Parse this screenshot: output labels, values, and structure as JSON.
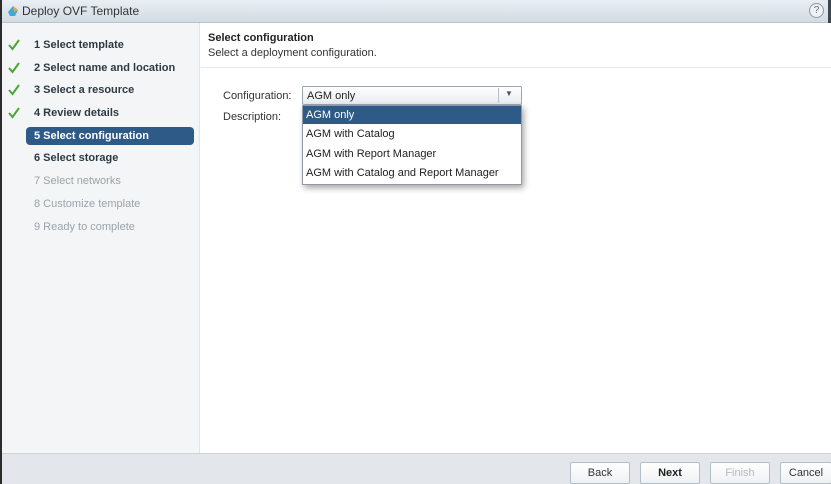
{
  "window": {
    "title": "Deploy OVF Template",
    "help_label": "?"
  },
  "steps": [
    {
      "label": "1  Select template",
      "state": "done"
    },
    {
      "label": "2  Select name and location",
      "state": "done"
    },
    {
      "label": "3  Select a resource",
      "state": "done"
    },
    {
      "label": "4  Review details",
      "state": "done"
    },
    {
      "label": "5  Select configuration",
      "state": "active"
    },
    {
      "label": "6  Select storage",
      "state": "next"
    },
    {
      "label": "7  Select networks",
      "state": "todo"
    },
    {
      "label": "8  Customize template",
      "state": "todo"
    },
    {
      "label": "9  Ready to complete",
      "state": "todo"
    }
  ],
  "main": {
    "title": "Select configuration",
    "subtitle": "Select a deployment configuration.",
    "configuration_label": "Configuration:",
    "description_label": "Description:",
    "selected_value": "AGM only",
    "options": [
      {
        "label": "AGM only",
        "selected": true
      },
      {
        "label": "AGM with Catalog",
        "selected": false
      },
      {
        "label": "AGM with Report Manager",
        "selected": false
      },
      {
        "label": "AGM with Catalog and Report Manager",
        "selected": false
      }
    ]
  },
  "footer": {
    "back_label": "Back",
    "next_label": "Next",
    "finish_label": "Finish",
    "cancel_label": "Cancel"
  },
  "colors": {
    "accent": "#2d5a87",
    "check": "#4aa832"
  }
}
